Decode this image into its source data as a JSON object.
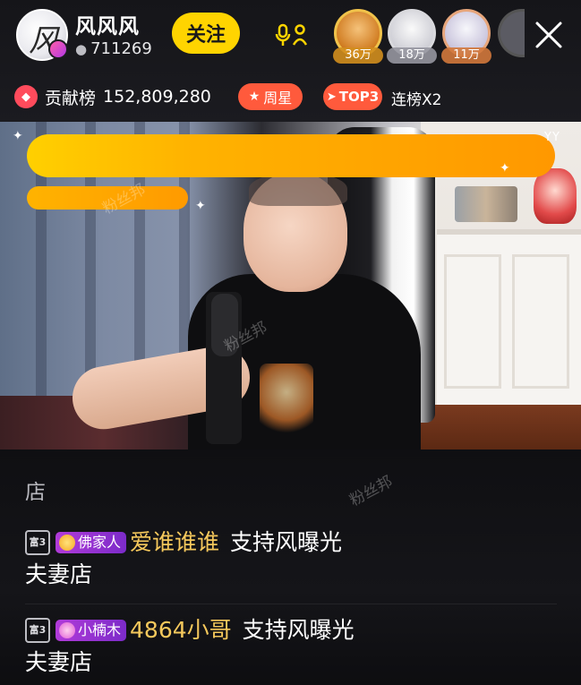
{
  "header": {
    "host_name": "风风风",
    "heat_count": "711269",
    "follow_label": "关注",
    "viewers": [
      {
        "count": "36万"
      },
      {
        "count": "18万"
      },
      {
        "count": "11万"
      }
    ],
    "contribution_label": "贡献榜",
    "contribution_value": "152,809,280",
    "week_star_label": "周星",
    "top_label": "TOP3",
    "streak_label": "连榜X2"
  },
  "video": {
    "corner_text": "YY",
    "watermark": "粉丝邦"
  },
  "chat": {
    "fragment": "店",
    "watermark": "粉丝邦",
    "messages": [
      {
        "level": "富3",
        "badge": "佛家人",
        "user": "爱谁谁谁",
        "text": "支持风曝光",
        "continuation": "夫妻店"
      },
      {
        "level": "富3",
        "badge": "小楠木",
        "user": "4864小哥",
        "text": "支持风曝光",
        "continuation": "夫妻店"
      }
    ]
  },
  "colors": {
    "follow": "#ffd400",
    "pill": "#ff5a3c",
    "badge": "#b13bd9",
    "username": "#f5c85c"
  }
}
